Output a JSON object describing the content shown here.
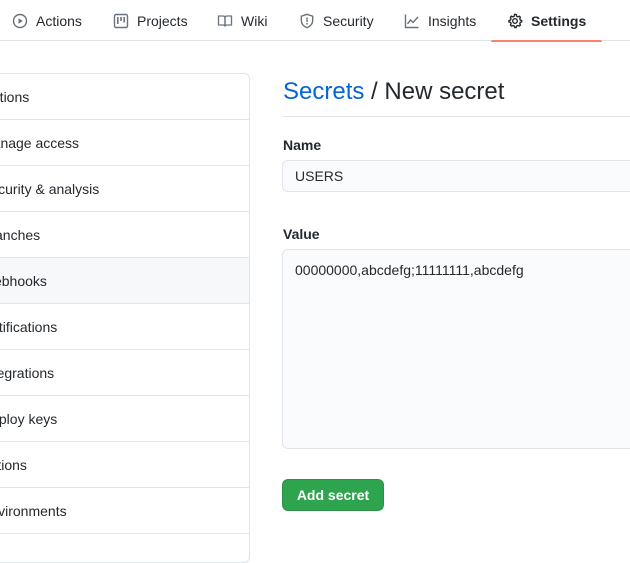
{
  "tabs": [
    {
      "label": "Actions",
      "icon": "play-circle-icon"
    },
    {
      "label": "Projects",
      "icon": "project-board-icon"
    },
    {
      "label": "Wiki",
      "icon": "book-icon"
    },
    {
      "label": "Security",
      "icon": "shield-icon"
    },
    {
      "label": "Insights",
      "icon": "graph-icon"
    },
    {
      "label": "Settings",
      "icon": "gear-icon",
      "selected": true
    }
  ],
  "sidebar": {
    "items": [
      {
        "label": "Options"
      },
      {
        "label": "Manage access"
      },
      {
        "label": "Security & analysis"
      },
      {
        "label": "Branches"
      },
      {
        "label": "Webhooks",
        "hovered": true
      },
      {
        "label": "Notifications"
      },
      {
        "label": "Integrations"
      },
      {
        "label": "Deploy keys"
      },
      {
        "label": "Actions"
      },
      {
        "label": "Environments"
      }
    ]
  },
  "main": {
    "breadcrumb_link": "Secrets",
    "separator": "/",
    "title": "New secret",
    "name_label": "Name",
    "name_value": "USERS",
    "value_label": "Value",
    "value_text": "00000000,abcdefg;11111111,abcdefg",
    "submit_label": "Add secret"
  },
  "colors": {
    "accent_link": "#0366d6",
    "selected_underline": "#f9826c",
    "primary_button": "#2ea44f"
  }
}
